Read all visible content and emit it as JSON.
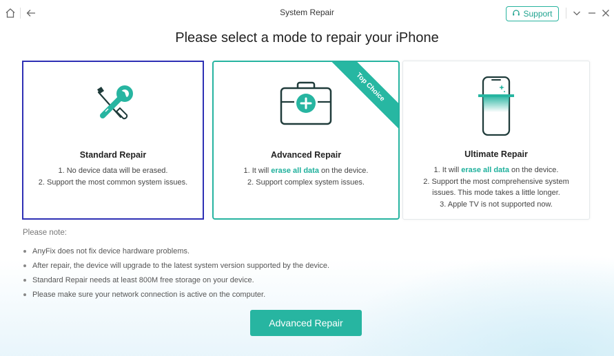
{
  "window": {
    "title": "System Repair",
    "support_label": "Support"
  },
  "heading": "Please select a mode to repair your iPhone",
  "cards": [
    {
      "title": "Standard Repair",
      "icon": "tools-icon",
      "lines": [
        "1. No device data will be erased.",
        "2. Support the most common system issues."
      ]
    },
    {
      "title": "Advanced Repair",
      "icon": "medical-kit-icon",
      "ribbon": "Top Choice",
      "line1_pre": "1. It will ",
      "line1_hl": "erase all data",
      "line1_post": " on the device.",
      "lines": [
        "2. Support complex system issues."
      ]
    },
    {
      "title": "Ultimate Repair",
      "icon": "phone-scan-icon",
      "line1_pre": "1. It will ",
      "line1_hl": "erase all data",
      "line1_post": " on the device.",
      "lines": [
        "2. Support the most comprehensive system",
        "issues. This mode takes a little longer.",
        "3. Apple TV is not supported now."
      ]
    }
  ],
  "notes": {
    "title": "Please note:",
    "items": [
      "AnyFix does not fix device hardware problems.",
      "After repair, the device will upgrade to the latest system version supported by the device.",
      "Standard Repair needs at least 800M free storage on your device.",
      "Please make sure your network connection is active on the computer."
    ]
  },
  "primary_button": "Advanced Repair",
  "colors": {
    "accent": "#27b5a1",
    "selected_border": "#2d2fb4",
    "highlight_text": "#1fb09c"
  }
}
